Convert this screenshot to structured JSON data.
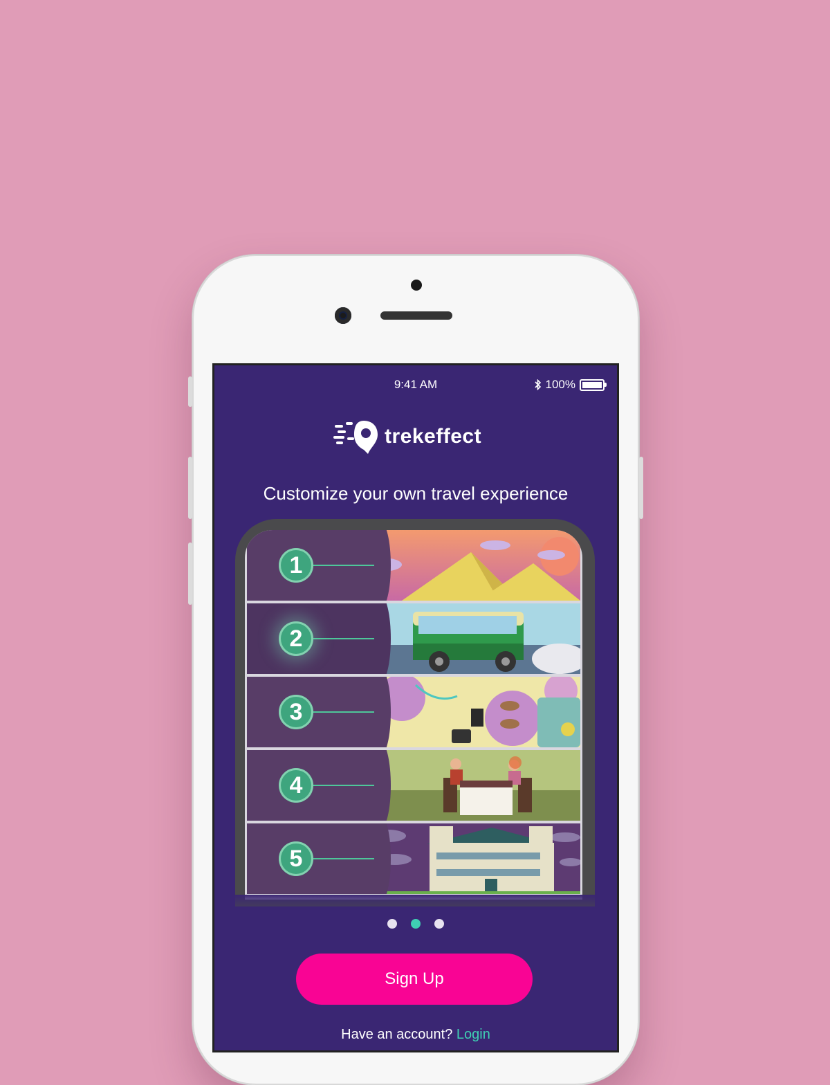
{
  "status_bar": {
    "time": "9:41 AM",
    "battery": "100%",
    "battery_level": 1.0,
    "bluetooth_icon": "bluetooth-icon"
  },
  "brand": {
    "name": "trekeffect",
    "accent": "#3fd0b3",
    "primary_button_color": "#f90494",
    "screen_background": "#3a2673"
  },
  "onboarding": {
    "headline": "Customize your own travel experience",
    "steps": [
      {
        "number": "1",
        "scene_icon": "desert-pyramids-scene"
      },
      {
        "number": "2",
        "scene_icon": "green-bus-scene",
        "highlighted": true
      },
      {
        "number": "3",
        "scene_icon": "packing-items-scene"
      },
      {
        "number": "4",
        "scene_icon": "couple-dinner-scene"
      },
      {
        "number": "5",
        "scene_icon": "hotel-building-scene"
      }
    ],
    "pager": {
      "total": 3,
      "current": 2
    }
  },
  "actions": {
    "signup_label": "Sign Up",
    "account_prompt": "Have an account?",
    "login_label": "Login"
  }
}
